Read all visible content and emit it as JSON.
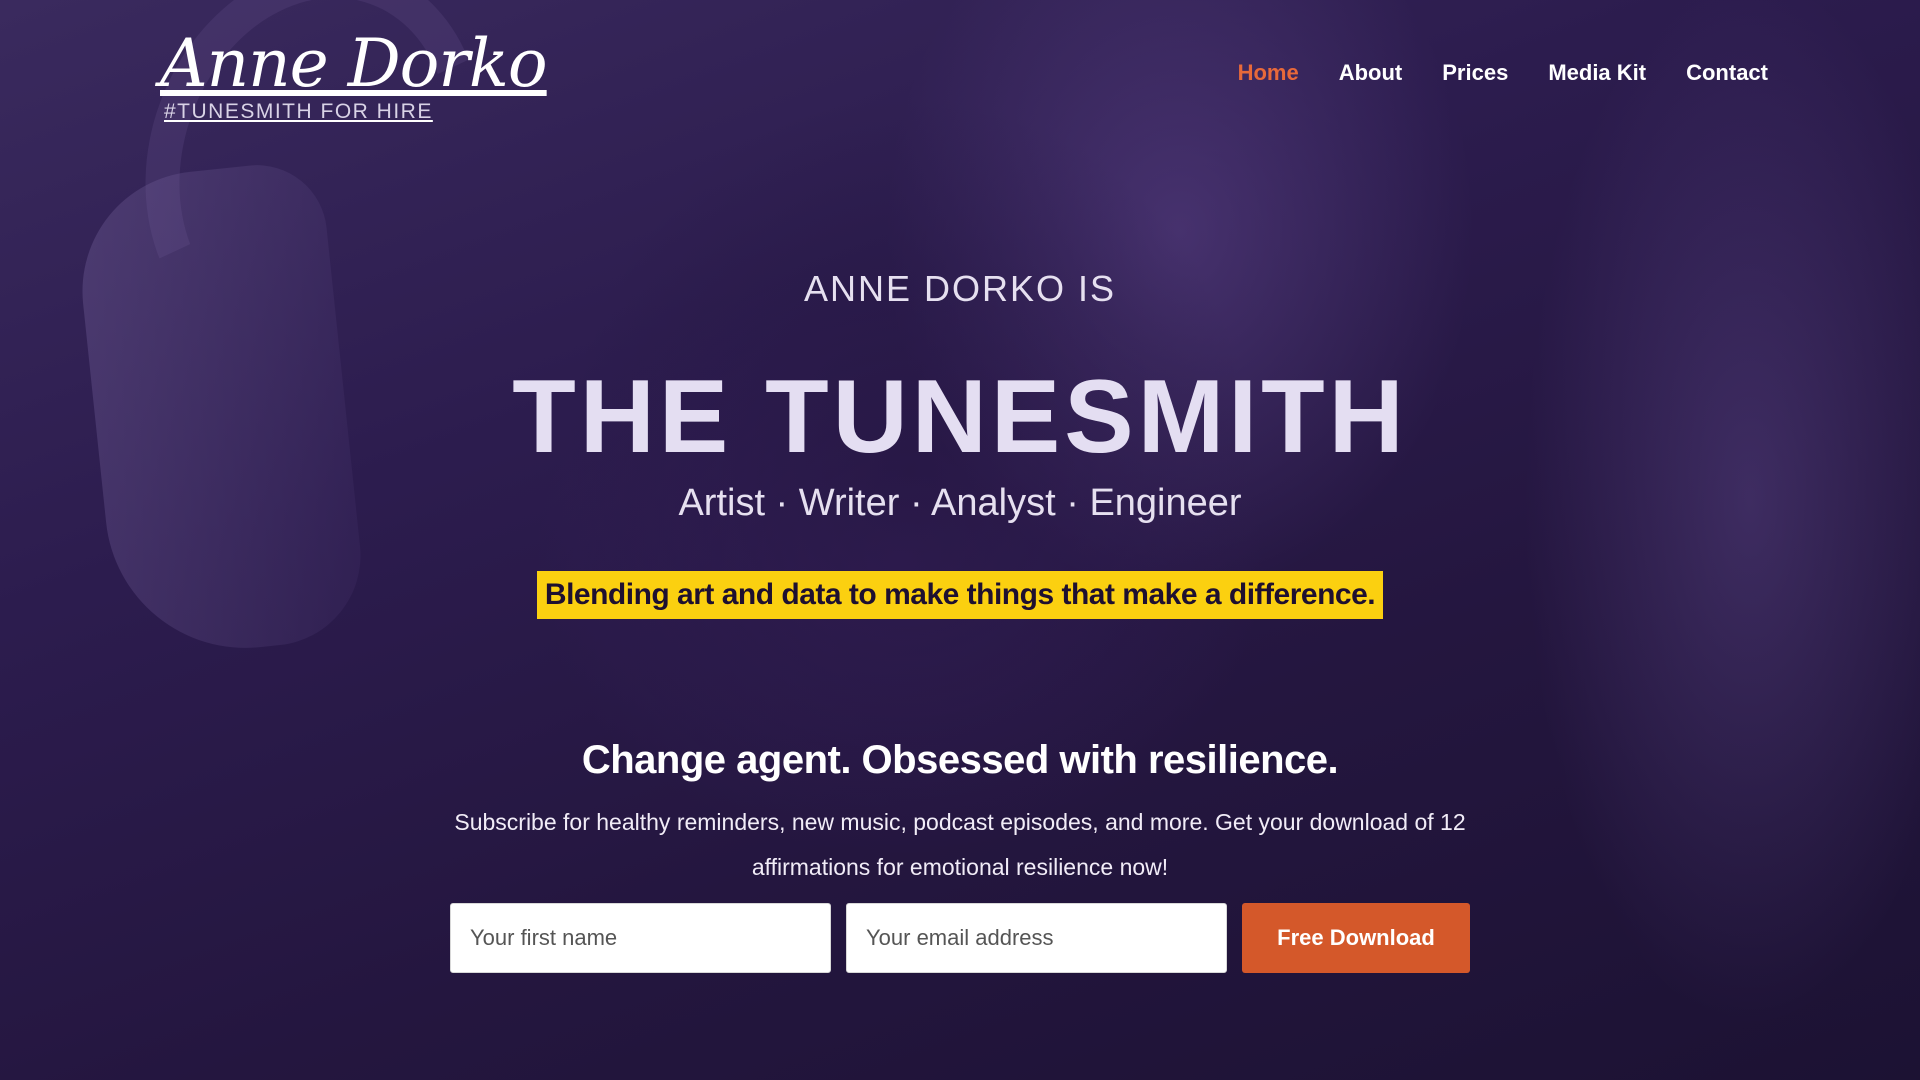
{
  "header": {
    "logo_name": "Anne Dorko",
    "logo_tagline": "#TUNESMITH FOR HIRE",
    "nav": [
      {
        "label": "Home",
        "active": true
      },
      {
        "label": "About",
        "active": false
      },
      {
        "label": "Prices",
        "active": false
      },
      {
        "label": "Media Kit",
        "active": false
      },
      {
        "label": "Contact",
        "active": false
      }
    ]
  },
  "hero": {
    "eyebrow": "ANNE DORKO IS",
    "headline": "THE TUNESMITH",
    "roles": "Artist · Writer · Analyst · Engineer",
    "tagline": "Blending art and data to make things that make a difference."
  },
  "signup": {
    "heading": "Change agent. Obsessed with resilience.",
    "blurb": "Subscribe for healthy reminders, new music, podcast episodes, and more. Get your download of 12 affirmations for emotional resilience now!",
    "first_name_placeholder": "Your first name",
    "email_placeholder": "Your email address",
    "button_label": "Free Download"
  },
  "colors": {
    "accent": "#e8693a",
    "button": "#d4582a",
    "highlight": "#fbd010",
    "background": "#2a1a4a"
  }
}
